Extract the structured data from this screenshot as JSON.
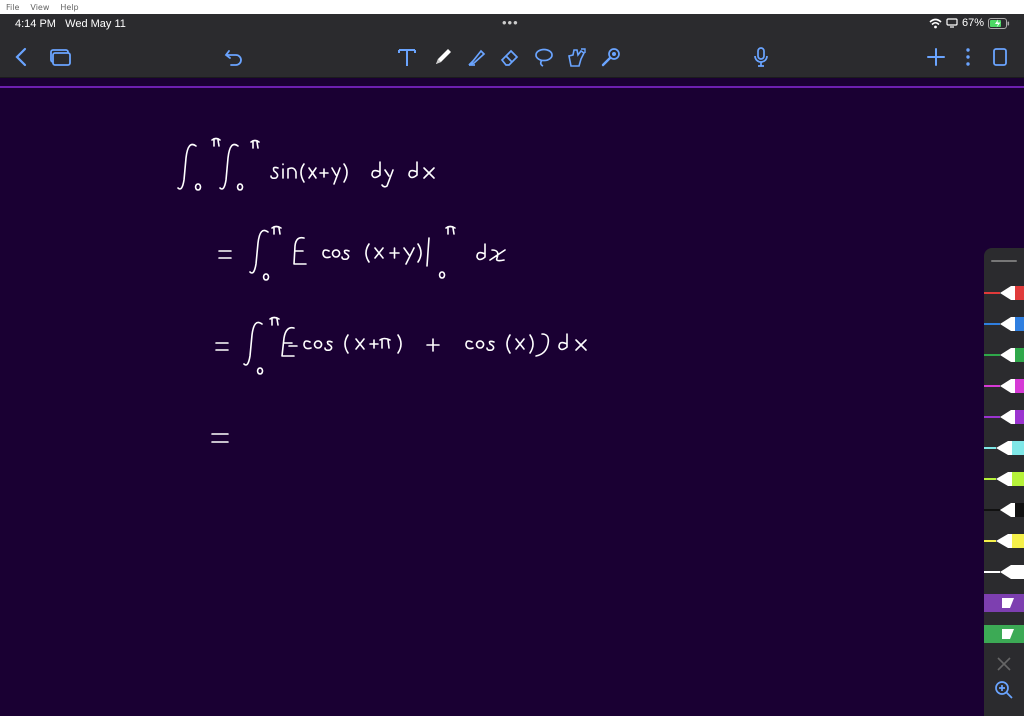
{
  "menubar": {
    "items": [
      "File",
      "View",
      "Help"
    ]
  },
  "status": {
    "time": "4:14 PM",
    "date": "Wed May 11",
    "battery": "67%"
  },
  "toolbar": {
    "icons": [
      "back-chevron-icon",
      "pages-icon",
      "undo-icon",
      "text-tool-icon",
      "pen-tool-icon",
      "highlighter-icon",
      "eraser-icon",
      "lasso-icon",
      "shapes-icon",
      "laser-pointer-icon",
      "microphone-icon",
      "plus-icon",
      "more-icon",
      "page-view-icon"
    ]
  },
  "palette": {
    "pens": [
      {
        "color": "#e03a3a",
        "kind": "pen"
      },
      {
        "color": "#2f7fe0",
        "kind": "pen"
      },
      {
        "color": "#2fa84a",
        "kind": "pen"
      },
      {
        "color": "#d63ad6",
        "kind": "pen"
      },
      {
        "color": "#9b34d0",
        "kind": "pen"
      },
      {
        "color": "#7fe7e7",
        "kind": "highlighter"
      },
      {
        "color": "#b6f23a",
        "kind": "highlighter"
      },
      {
        "color": "#111111",
        "kind": "pen"
      },
      {
        "color": "#f5f04a",
        "kind": "highlighter"
      },
      {
        "color": "#ffffff",
        "kind": "pen"
      },
      {
        "color": "#7d3fb0",
        "kind": "marker"
      },
      {
        "color": "#3caa55",
        "kind": "marker"
      }
    ],
    "ink_color": "#ffffff"
  }
}
